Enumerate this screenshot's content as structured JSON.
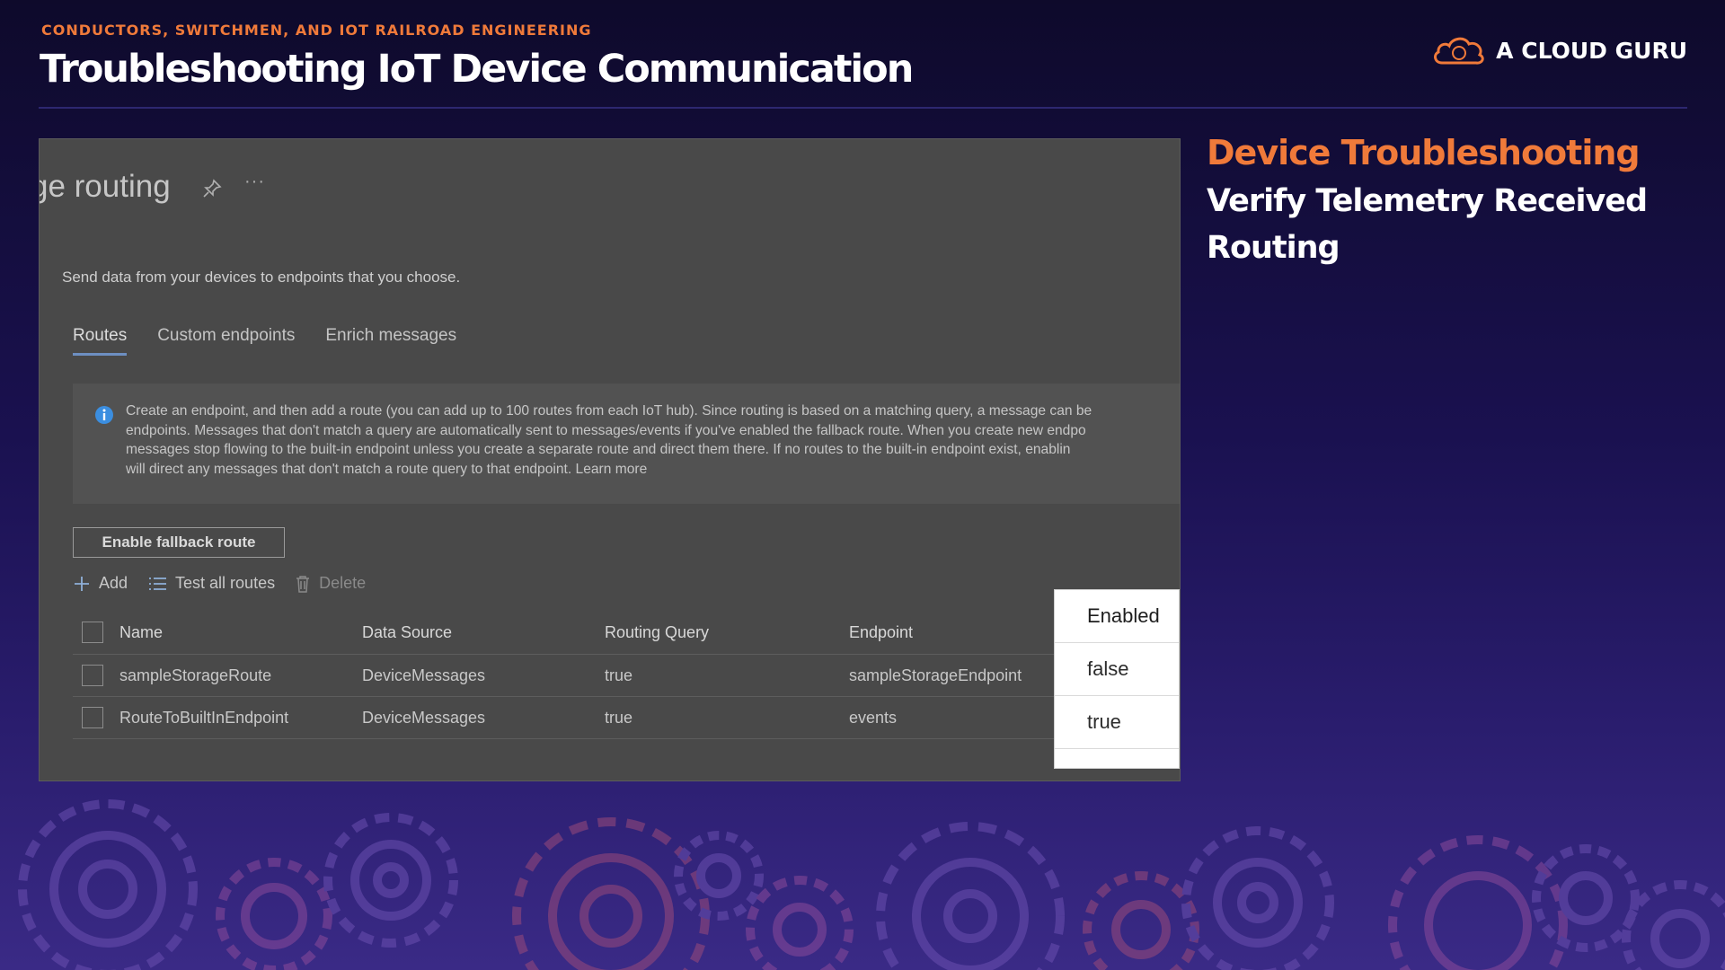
{
  "header": {
    "subtitle": "CONDUCTORS, SWITCHMEN, AND IOT RAILROAD ENGINEERING",
    "title": "Troubleshooting IoT Device Communication",
    "logo_text": "A CLOUD GURU"
  },
  "portal": {
    "page_title": "ge routing",
    "description": "Send data from your devices to endpoints that you choose.",
    "tabs": [
      {
        "label": "Routes",
        "active": true
      },
      {
        "label": "Custom endpoints",
        "active": false
      },
      {
        "label": "Enrich messages",
        "active": false
      }
    ],
    "info_lines": [
      "Create an endpoint, and then add a route (you can add up to 100 routes from each IoT hub). Since routing is based on a matching query, a message can be",
      "endpoints. Messages that don't match a query are automatically sent to messages/events if you've enabled the fallback route. When you create new endpo",
      "messages stop flowing to the built-in endpoint unless you create a separate route and direct them there. If no routes to the built-in endpoint exist, enablin",
      "will direct any messages that don't match a route query to that endpoint. Learn more"
    ],
    "fallback_button": "Enable fallback route",
    "toolbar": {
      "add": "Add",
      "test_all": "Test all routes",
      "delete": "Delete"
    },
    "table": {
      "headers": [
        "Name",
        "Data Source",
        "Routing Query",
        "Endpoint"
      ],
      "rows": [
        {
          "name": "sampleStorageRoute",
          "source": "DeviceMessages",
          "query": "true",
          "endpoint": "sampleStorageEndpoint"
        },
        {
          "name": "RouteToBuiltInEndpoint",
          "source": "DeviceMessages",
          "query": "true",
          "endpoint": "events"
        }
      ]
    },
    "enabled_column": {
      "header": "Enabled",
      "values": [
        "false",
        "true"
      ]
    }
  },
  "side": {
    "heading": "Device Troubleshooting",
    "items": [
      "Verify Telemetry Received",
      "Routing"
    ]
  },
  "colors": {
    "accent": "#f07a3a",
    "background": "#1a1150",
    "info_icon": "#3b8ee0"
  }
}
